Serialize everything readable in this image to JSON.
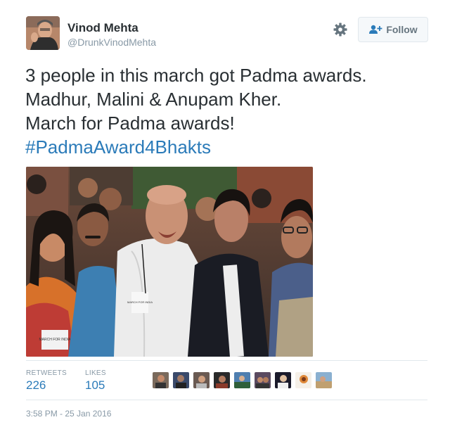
{
  "tweet": {
    "display_name": "Vinod Mehta",
    "handle": "@DrunkVinodMehta",
    "follow_label": "Follow",
    "text_lines": [
      "3 people in this march got Padma awards.",
      "Madhur, Malini & Anupam Kher.",
      "March for Padma awards!"
    ],
    "hashtag": "#PadmaAward4Bhakts",
    "timestamp": "3:58 PM - 25 Jan 2016"
  },
  "media": {
    "badge_text_1": "MARCH FOR INDIA",
    "badge_text_2": "MARCH FOR INDIA"
  },
  "stats": {
    "retweets_label": "RETWEETS",
    "retweets_count": "226",
    "likes_label": "LIKES",
    "likes_count": "105"
  },
  "icons": {
    "settings": "gear-icon",
    "follow": "add-user-icon"
  },
  "colors": {
    "link": "#2b7bb9",
    "muted": "#8899a6",
    "text": "#292f33"
  }
}
